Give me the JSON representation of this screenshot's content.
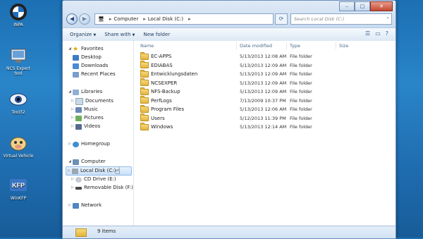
{
  "desktop": {
    "icons": [
      {
        "label": "INPA",
        "icon": "bmw-logo-icon",
        "color": "#1a6cc6"
      },
      {
        "label": "NCS Expert tool",
        "icon": "ncs-expert-icon",
        "color": "#bcd4ef"
      },
      {
        "label": "Tool32",
        "icon": "tool32-eye-icon",
        "color": "#2a4a8a"
      },
      {
        "label": "Virtual Vehicle",
        "icon": "cow-icon",
        "color": "#e6c36a"
      },
      {
        "label": "WinKFP",
        "icon": "kfp-icon",
        "color": "#3a76c4"
      }
    ]
  },
  "window": {
    "caption": {
      "minimize": "–",
      "maximize": "□",
      "close": "✕"
    },
    "address": {
      "root_icon": "computer-icon",
      "segments": [
        "Computer",
        "Local Disk (C:)"
      ]
    },
    "search_placeholder": "Search Local Disk (C:)",
    "toolbar": {
      "organize": "Organize",
      "share": "Share with",
      "new_folder": "New folder"
    },
    "nav": {
      "favorites": "Favorites",
      "desktop": "Desktop",
      "downloads": "Downloads",
      "recent": "Recent Places",
      "libraries": "Libraries",
      "documents": "Documents",
      "music": "Music",
      "pictures": "Pictures",
      "videos": "Videos",
      "homegroup": "Homegroup",
      "computer": "Computer",
      "local_disk": "Local Disk (C:)",
      "cd_drive": "CD Drive (E:)",
      "removable": "Removable Disk (F:)",
      "network": "Network"
    },
    "columns": {
      "name": "Name",
      "date": "Date modified",
      "type": "Type",
      "size": "Size"
    },
    "files": [
      {
        "name": "EC-APPS",
        "date": "5/13/2013 12:08 AM",
        "type": "File folder"
      },
      {
        "name": "EDIABAS",
        "date": "5/13/2013 12:09 AM",
        "type": "File folder"
      },
      {
        "name": "Entwicklungsdaten",
        "date": "5/13/2013 12:09 AM",
        "type": "File folder"
      },
      {
        "name": "NCSEXPER",
        "date": "5/13/2013 12:09 AM",
        "type": "File folder"
      },
      {
        "name": "NFS-Backup",
        "date": "5/13/2013 12:09 AM",
        "type": "File folder"
      },
      {
        "name": "PerfLogs",
        "date": "7/13/2009 10:37 PM",
        "type": "File folder"
      },
      {
        "name": "Program Files",
        "date": "5/13/2013 12:06 AM",
        "type": "File folder"
      },
      {
        "name": "Users",
        "date": "5/12/2013 11:39 PM",
        "type": "File folder"
      },
      {
        "name": "Windows",
        "date": "5/13/2013 12:14 AM",
        "type": "File folder"
      }
    ],
    "status": {
      "count": "9 items"
    }
  }
}
